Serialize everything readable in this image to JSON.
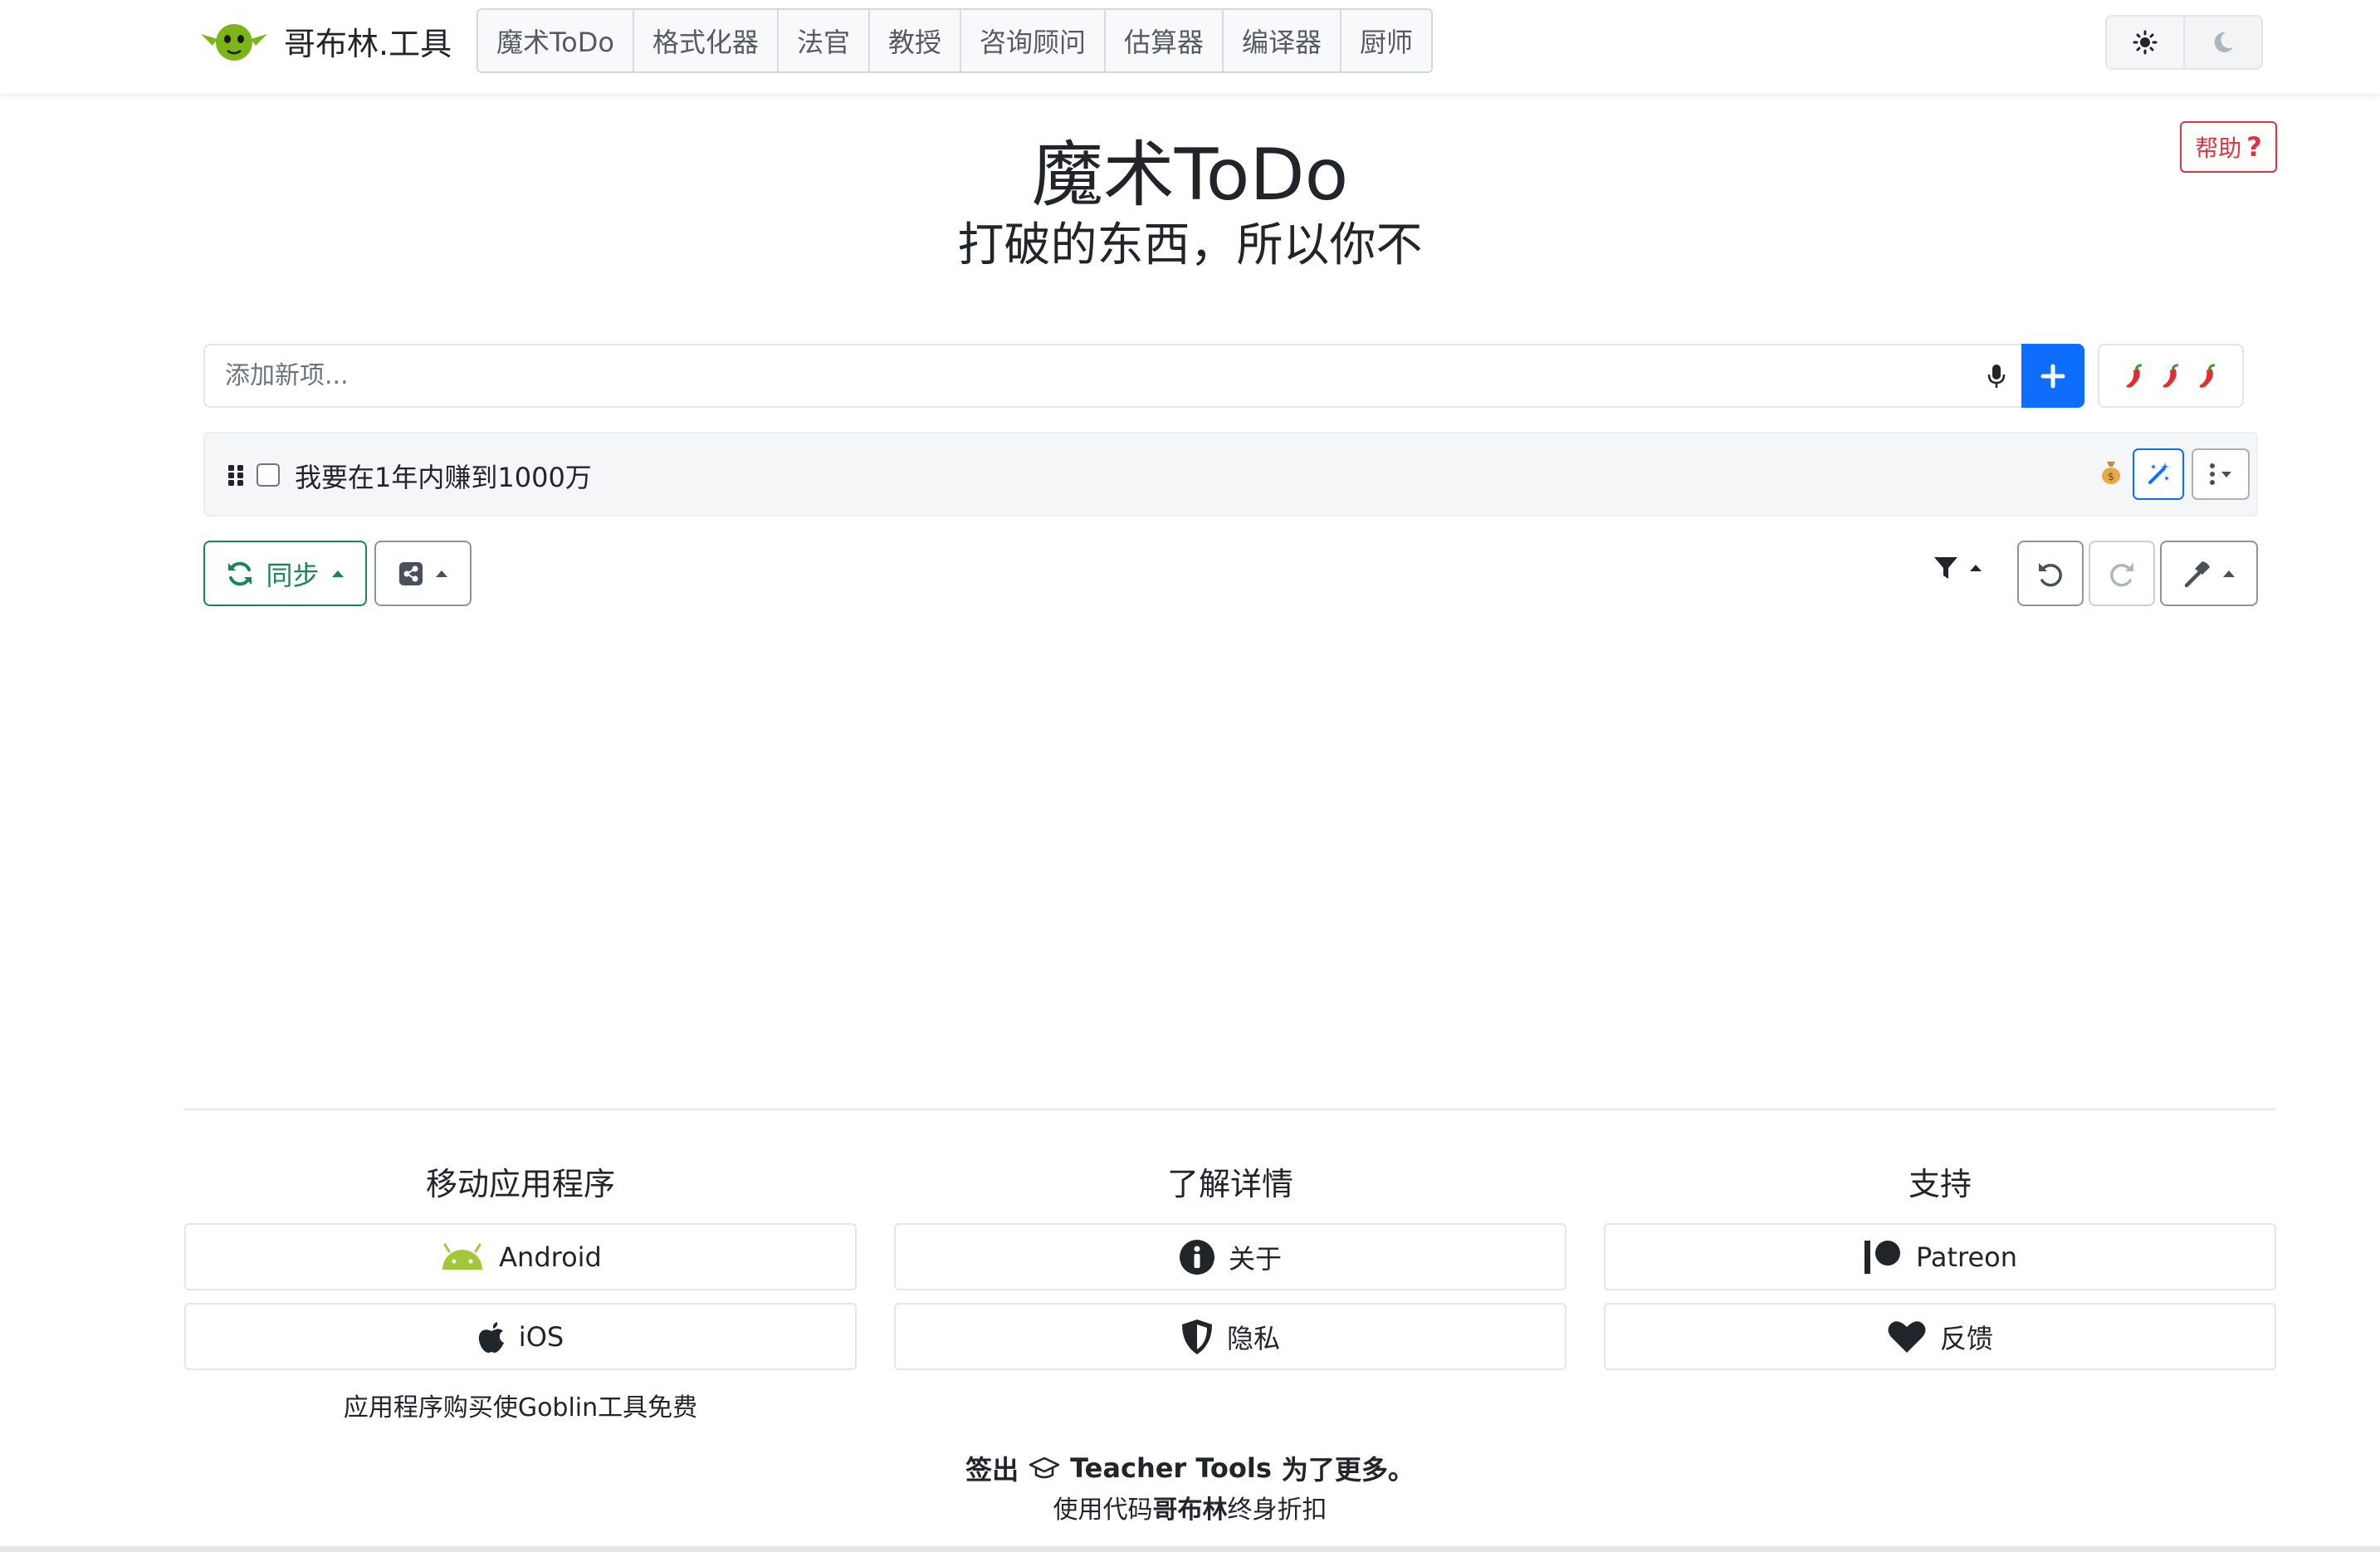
{
  "nav": {
    "brand": "哥布林.工具",
    "tabs": [
      "魔术ToDo",
      "格式化器",
      "法官",
      "教授",
      "咨询顾问",
      "估算器",
      "编译器",
      "厨师"
    ],
    "theme_light_icon": "sun-icon",
    "theme_dark_icon": "moon-icon"
  },
  "header": {
    "help_label": "帮助",
    "title": "魔术ToDo",
    "subtitle": "打破的东西，所以你不"
  },
  "new_item": {
    "placeholder": "添加新项...",
    "mic_icon": "microphone-icon",
    "add_icon": "plus-icon",
    "spiciness_icons": [
      "chili-icon",
      "chili-icon",
      "chili-icon"
    ]
  },
  "todos": [
    {
      "text": "我要在1年内赚到1000万",
      "checked": false,
      "estimate_icon": "money-bag-icon"
    }
  ],
  "toolbar": {
    "sync_label": "同步"
  },
  "footer": {
    "columns": [
      {
        "heading": "移动应用程序",
        "buttons": [
          "Android",
          "iOS"
        ],
        "note": "应用程序购买使Goblin工具免费"
      },
      {
        "heading": "了解详情",
        "buttons": [
          "关于",
          "隐私"
        ]
      },
      {
        "heading": "支持",
        "buttons": [
          "Patreon",
          "反馈"
        ]
      }
    ],
    "promo_prefix": "签出",
    "promo_brand": "Teacher Tools",
    "promo_suffix": "为了更多。",
    "discount_prefix": "使用代码",
    "discount_code": "哥布林",
    "discount_suffix": "终身折扣"
  },
  "colors": {
    "primary": "#0d6efd",
    "success": "#198754",
    "danger": "#dc3545",
    "android": "#a4c639"
  }
}
